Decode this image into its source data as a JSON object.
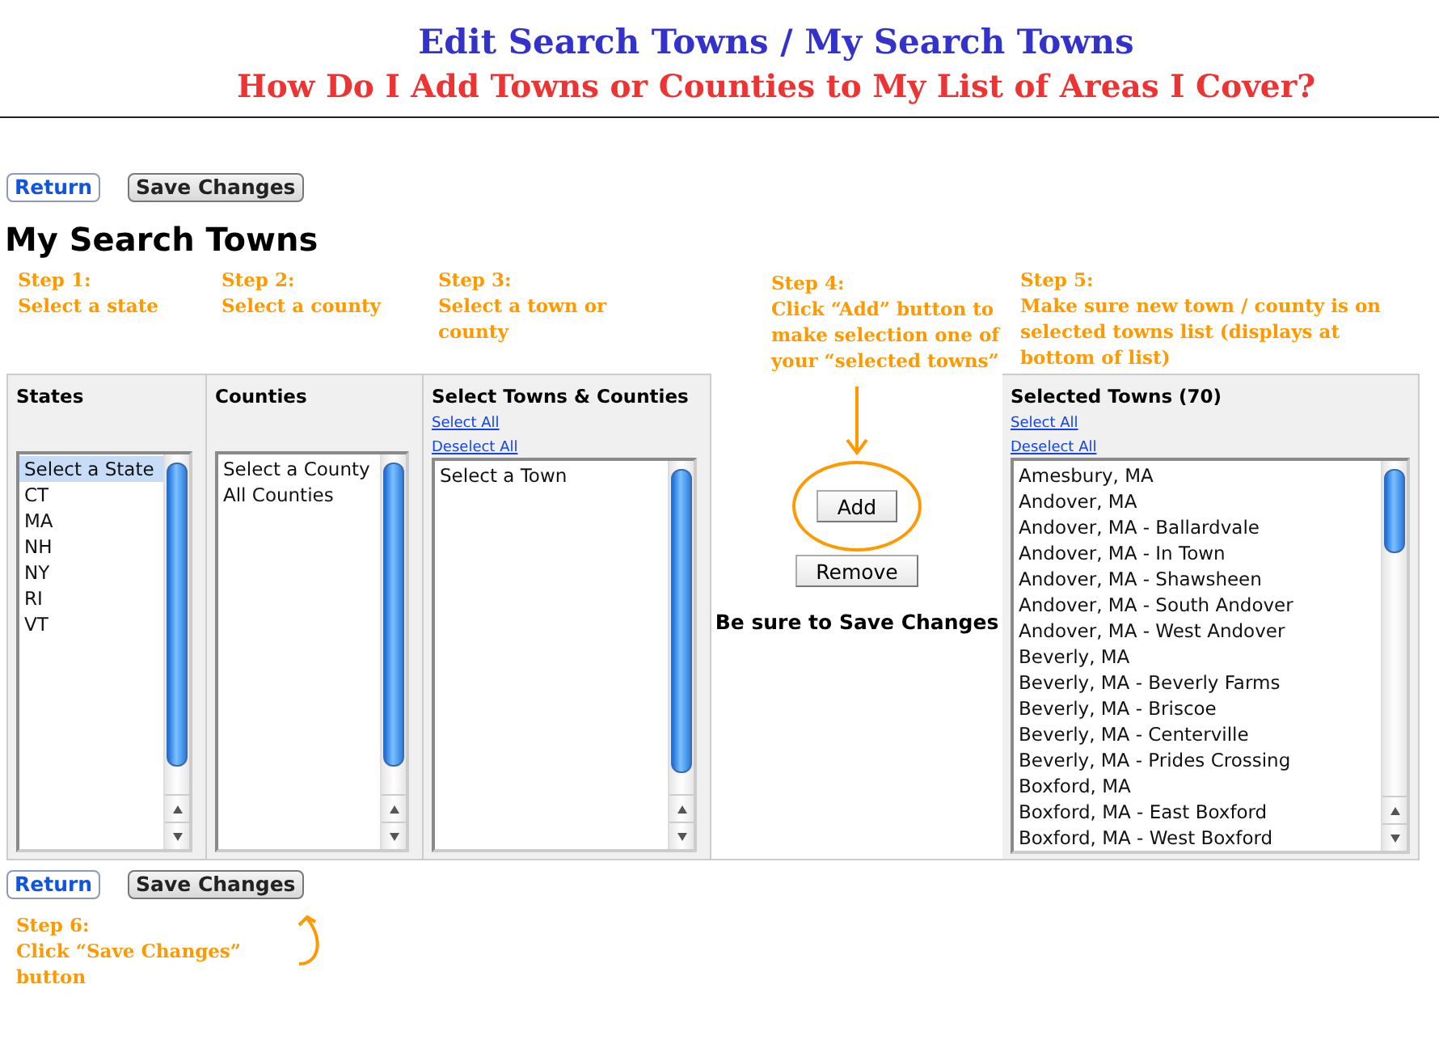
{
  "header": {
    "title": "Edit Search Towns / My Search Towns",
    "subtitle": "How Do I Add Towns or Counties to My List of Areas I Cover?"
  },
  "top_buttons": [
    {
      "kind": "link",
      "label": "Return"
    },
    {
      "kind": "save",
      "label": "Save Changes"
    }
  ],
  "page_title": "My Search Towns",
  "columns": [
    {
      "kind": "list",
      "step": {
        "label": "Step 1:",
        "text": "Select a state"
      },
      "heading": "States",
      "items": [
        {
          "label": "Select a State",
          "selected": true
        },
        {
          "label": "CT",
          "selected": false
        },
        {
          "label": "MA",
          "selected": false
        },
        {
          "label": "NH",
          "selected": false
        },
        {
          "label": "NY",
          "selected": false
        },
        {
          "label": "RI",
          "selected": false
        },
        {
          "label": "VT",
          "selected": false
        }
      ]
    },
    {
      "kind": "list",
      "step": {
        "label": "Step 2:",
        "text": "Select a county"
      },
      "heading": "Counties",
      "items": [
        {
          "label": "Select a County",
          "selected": false
        },
        {
          "label": "All Counties",
          "selected": false
        }
      ]
    },
    {
      "kind": "list",
      "step": {
        "label": "Step 3:",
        "text": "Select a town or county"
      },
      "heading": "Select Towns & Counties",
      "links": [
        "Select All",
        "Deselect All"
      ],
      "items": [
        {
          "label": "Select a Town",
          "selected": false
        }
      ]
    },
    {
      "kind": "actions",
      "step": {
        "label": "Step 4:",
        "text": "Click “Add” button to make selection one of your “selected towns”"
      },
      "buttons": [
        "Add",
        "Remove"
      ],
      "note": "Be sure to Save Changes"
    },
    {
      "kind": "list",
      "step": {
        "label": "Step 5:",
        "text": "Make sure new town / county is on selected towns list (displays at bottom of list)"
      },
      "heading": "Selected Towns (70)",
      "links": [
        "Select All",
        "Deselect All"
      ],
      "items": [
        {
          "label": "Amesbury, MA",
          "selected": false
        },
        {
          "label": "Andover, MA",
          "selected": false
        },
        {
          "label": "Andover, MA - Ballardvale",
          "selected": false
        },
        {
          "label": "Andover, MA - In Town",
          "selected": false
        },
        {
          "label": "Andover, MA - Shawsheen",
          "selected": false
        },
        {
          "label": "Andover, MA - South Andover",
          "selected": false
        },
        {
          "label": "Andover, MA - West Andover",
          "selected": false
        },
        {
          "label": "Beverly, MA",
          "selected": false
        },
        {
          "label": "Beverly, MA - Beverly Farms",
          "selected": false
        },
        {
          "label": "Beverly, MA - Briscoe",
          "selected": false
        },
        {
          "label": "Beverly, MA - Centerville",
          "selected": false
        },
        {
          "label": "Beverly, MA - Prides Crossing",
          "selected": false
        },
        {
          "label": "Boxford, MA",
          "selected": false
        },
        {
          "label": "Boxford, MA - East Boxford",
          "selected": false
        },
        {
          "label": "Boxford, MA - West Boxford",
          "selected": false
        }
      ]
    }
  ],
  "bottom_buttons": [
    {
      "kind": "link",
      "label": "Return"
    },
    {
      "kind": "save",
      "label": "Save Changes"
    }
  ],
  "final_step": {
    "label": "Step 6:",
    "text": "Click “Save Changes” button"
  }
}
